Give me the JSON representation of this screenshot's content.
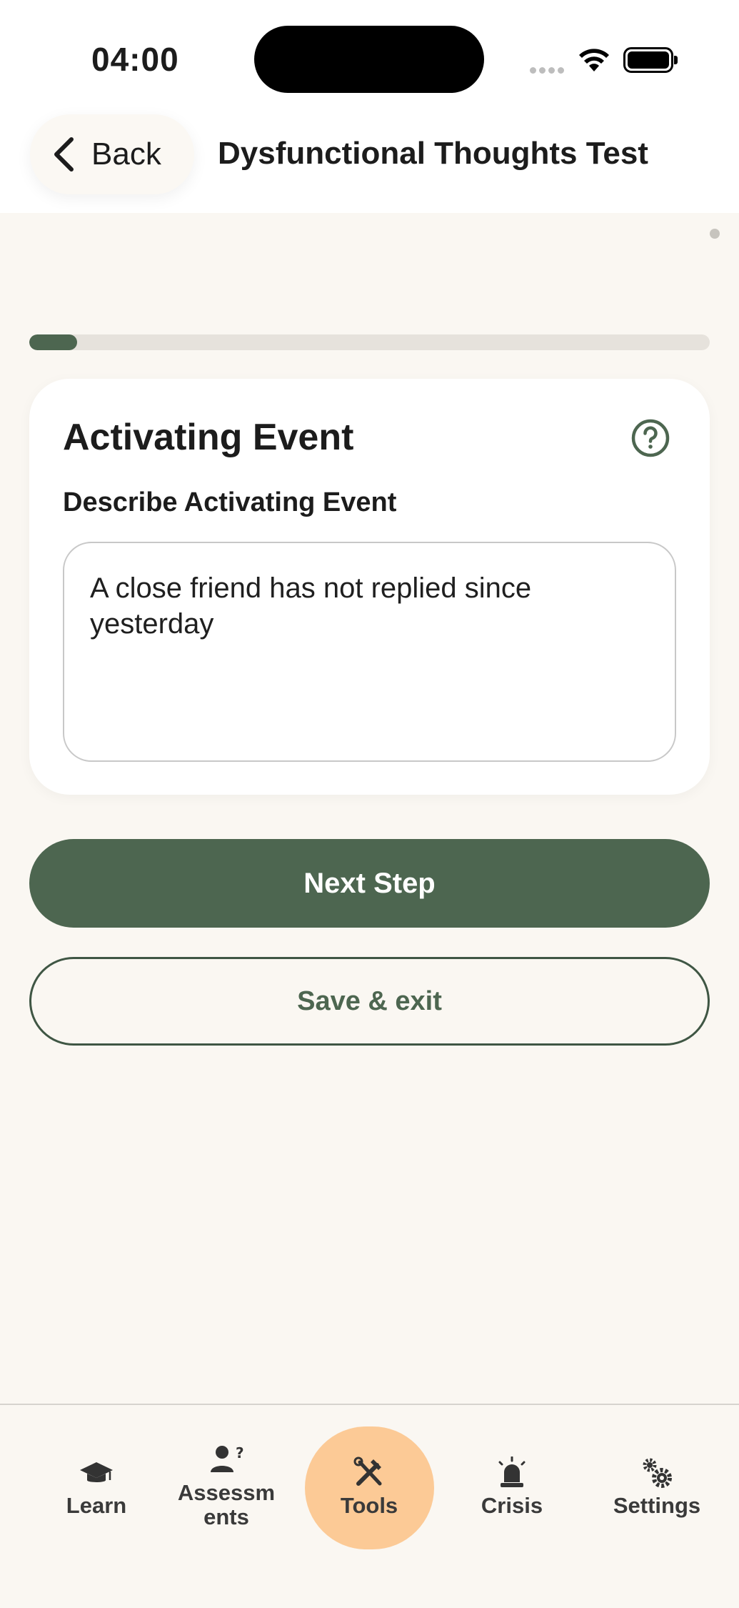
{
  "status_bar": {
    "time": "04:00"
  },
  "header": {
    "back_label": "Back",
    "title": "Dysfunctional Thoughts Test"
  },
  "progress": {
    "fraction": 0.07
  },
  "card": {
    "title": "Activating Event",
    "field_label": "Describe Activating Event",
    "field_value": "A close friend has not replied since yesterday",
    "help_icon": "question-circle-icon"
  },
  "actions": {
    "next_label": "Next Step",
    "save_exit_label": "Save & exit"
  },
  "tabbar": {
    "items": [
      {
        "label": "Learn",
        "icon": "graduation-cap-icon"
      },
      {
        "label": "Assessm\nents",
        "icon": "person-question-icon"
      },
      {
        "label": "Tools",
        "icon": "tools-icon",
        "active": true
      },
      {
        "label": "Crisis",
        "icon": "siren-icon"
      },
      {
        "label": "Settings",
        "icon": "gears-icon"
      }
    ]
  },
  "colors": {
    "accent": "#4d6650",
    "background": "#faf7f2",
    "active_tab": "#fcca96"
  }
}
